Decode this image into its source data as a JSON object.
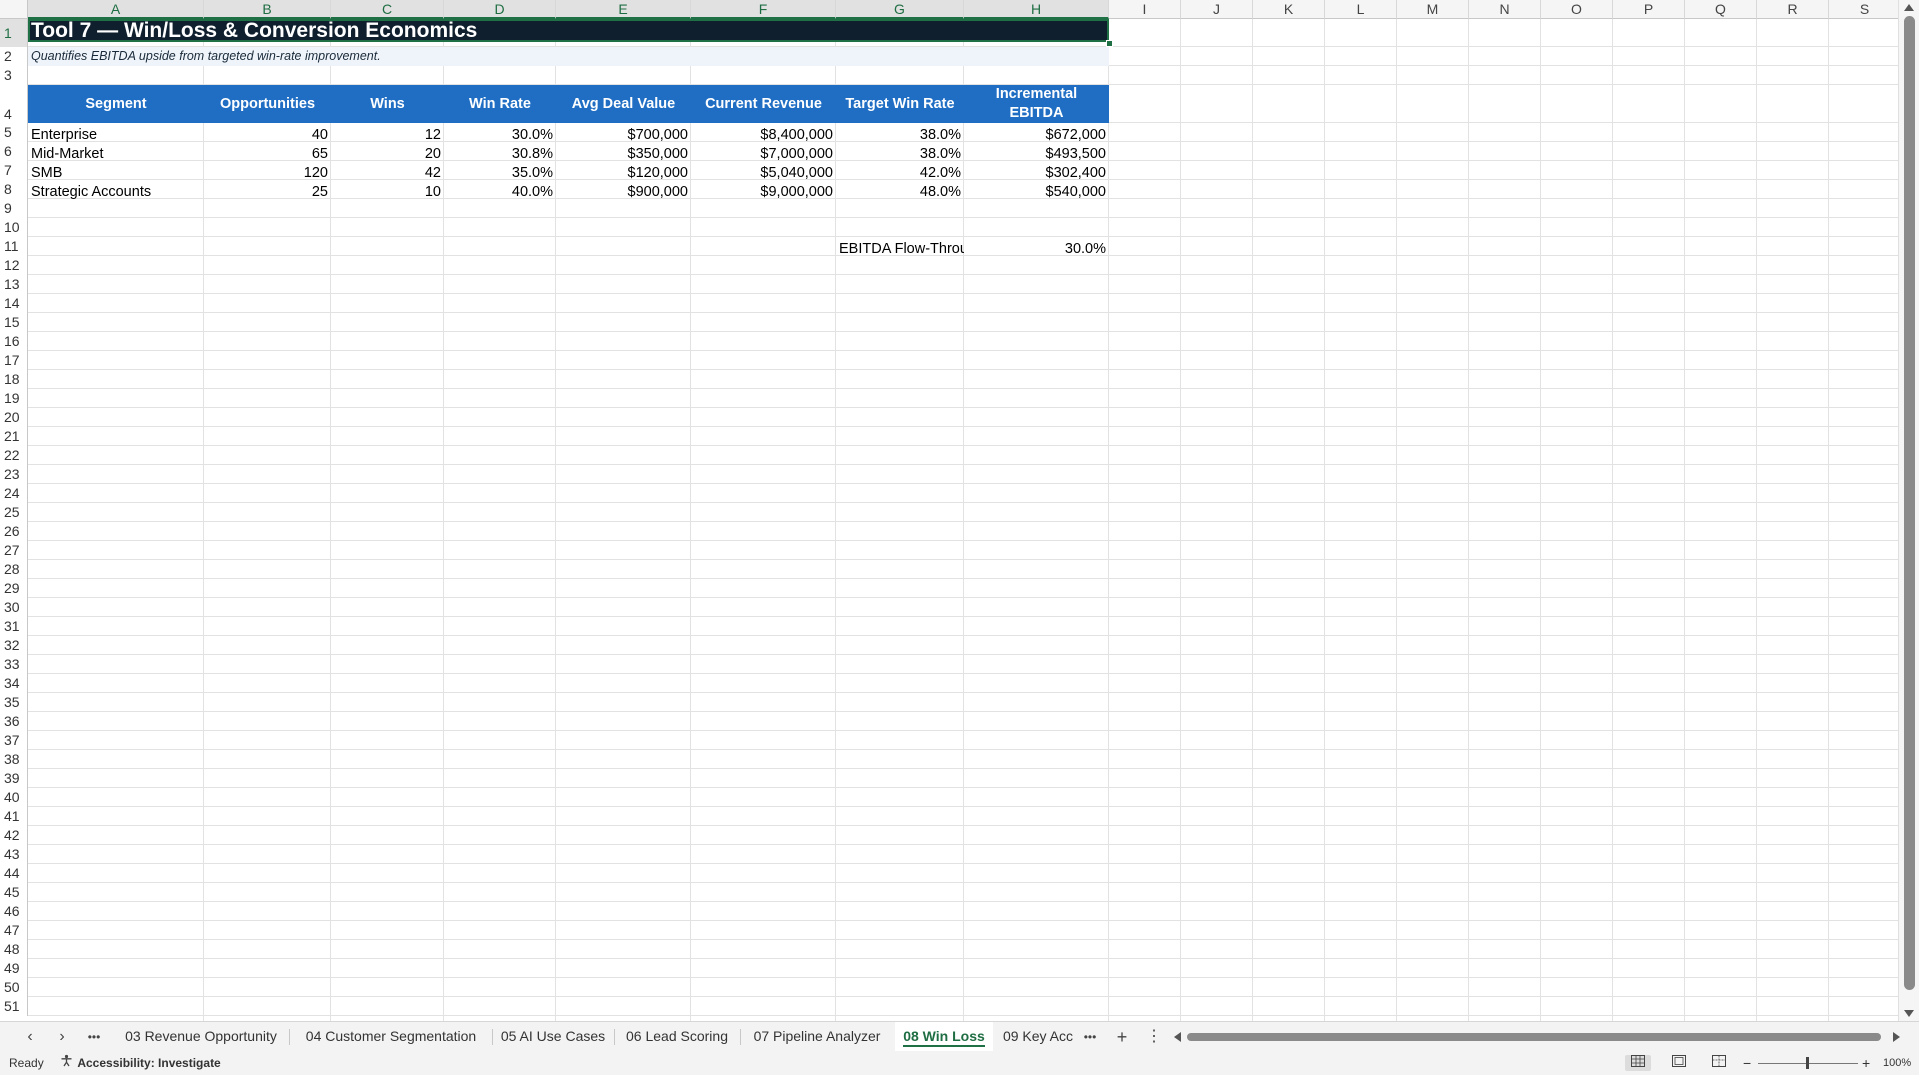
{
  "columns": [
    "A",
    "B",
    "C",
    "D",
    "E",
    "F",
    "G",
    "H",
    "I",
    "J",
    "K",
    "L",
    "M",
    "N",
    "O",
    "P",
    "Q",
    "R",
    "S"
  ],
  "rows": [
    "1",
    "2",
    "3",
    "4",
    "5",
    "6",
    "7",
    "8",
    "9",
    "10",
    "11",
    "12",
    "13",
    "14",
    "15",
    "16",
    "17",
    "18",
    "19",
    "20",
    "21",
    "22",
    "23",
    "24",
    "25",
    "26",
    "27",
    "28",
    "29",
    "30",
    "31",
    "32",
    "33",
    "34",
    "35",
    "36",
    "37",
    "38",
    "39",
    "40",
    "41",
    "42",
    "43",
    "44",
    "45",
    "46",
    "47",
    "48",
    "49",
    "50",
    "51"
  ],
  "sheet": {
    "title": "Tool 7 — Win/Loss & Conversion Economics",
    "subtitle": "Quantifies EBITDA upside from targeted win-rate improvement.",
    "headers": [
      "Segment",
      "Opportunities",
      "Wins",
      "Win Rate",
      "Avg Deal Value",
      "Current Revenue",
      "Target Win Rate",
      "Incremental EBITDA"
    ],
    "rows": [
      [
        "Enterprise",
        "40",
        "12",
        "30.0%",
        "$700,000",
        "$8,400,000",
        "38.0%",
        "$672,000"
      ],
      [
        "Mid-Market",
        "65",
        "20",
        "30.8%",
        "$350,000",
        "$7,000,000",
        "38.0%",
        "$493,500"
      ],
      [
        "SMB",
        "120",
        "42",
        "35.0%",
        "$120,000",
        "$5,040,000",
        "42.0%",
        "$302,400"
      ],
      [
        "Strategic Accounts",
        "25",
        "10",
        "40.0%",
        "$900,000",
        "$9,000,000",
        "48.0%",
        "$540,000"
      ]
    ],
    "flow_label": "EBITDA Flow-Throu",
    "flow_value": "30.0%"
  },
  "tabs": {
    "items": [
      "03 Revenue Opportunity",
      "04 Customer Segmentation",
      "05 AI Use Cases",
      "06 Lead Scoring",
      "07 Pipeline Analyzer",
      "08 Win Loss",
      "09 Key Acc"
    ],
    "active": "08 Win Loss",
    "more": "•••",
    "add": "+",
    "options": "⋮"
  },
  "status": {
    "ready": "Ready",
    "accessibility": "Accessibility: Investigate",
    "zoom": "100%",
    "zoom_minus": "−",
    "zoom_plus": "+"
  },
  "colors": {
    "title_bg": "#0f1f2d",
    "header_bg": "#1f6ec4",
    "subtitle_bg": "#eef4fa",
    "accent": "#1f7145"
  }
}
